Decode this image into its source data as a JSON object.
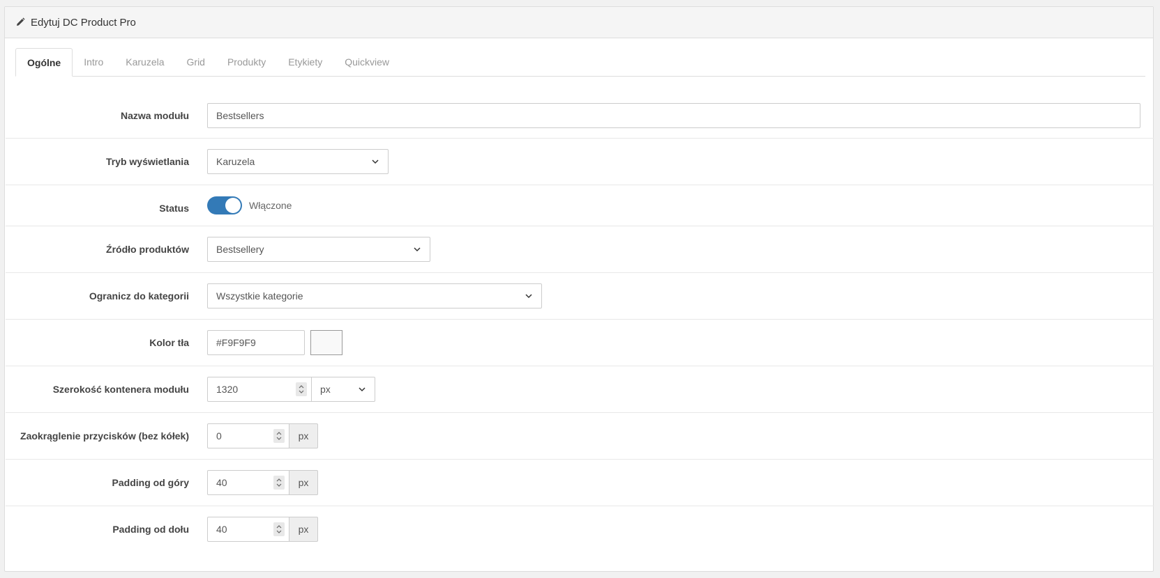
{
  "panel": {
    "title": "Edytuj DC Product Pro",
    "title_icon": "pencil-icon"
  },
  "tabs": [
    {
      "label": "Ogólne",
      "active": true
    },
    {
      "label": "Intro"
    },
    {
      "label": "Karuzela"
    },
    {
      "label": "Grid"
    },
    {
      "label": "Produkty"
    },
    {
      "label": "Etykiety"
    },
    {
      "label": "Quickview"
    }
  ],
  "form": {
    "module_name": {
      "label": "Nazwa modułu",
      "value": "Bestsellers"
    },
    "display_mode": {
      "label": "Tryb wyświetlania",
      "value": "Karuzela"
    },
    "status": {
      "label": "Status",
      "value": "Włączone",
      "on": true,
      "accent": "#337ab7"
    },
    "product_source": {
      "label": "Źródło produktów",
      "value": "Bestsellery"
    },
    "category_limit": {
      "label": "Ogranicz do kategorii",
      "value": "Wszystkie kategorie"
    },
    "bg_color": {
      "label": "Kolor tła",
      "value": "#F9F9F9",
      "swatch": "#F9F9F9"
    },
    "container_width": {
      "label": "Szerokość kontenera modułu",
      "value": "1320",
      "unit": "px"
    },
    "button_radius": {
      "label": "Zaokrąglenie przycisków (bez kółek)",
      "value": "0",
      "unit": "px"
    },
    "padding_top": {
      "label": "Padding od góry",
      "value": "40",
      "unit": "px"
    },
    "padding_bottom": {
      "label": "Padding od dołu",
      "value": "40",
      "unit": "px"
    }
  }
}
